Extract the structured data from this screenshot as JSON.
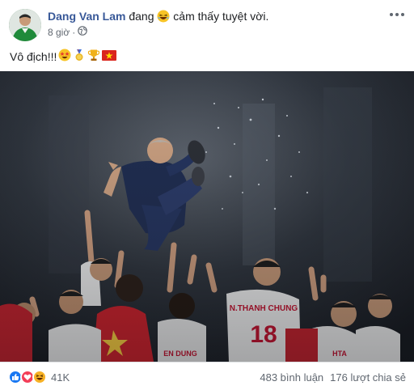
{
  "post": {
    "author": "Dang Van Lam",
    "feeling_prefix": "đang",
    "feeling_icon": "laughing-emoji",
    "feeling_text": "cảm thấy tuyệt vời.",
    "timestamp": "8 giờ",
    "privacy_icon": "globe-icon",
    "caption_text": "Vô địch!!!",
    "caption_emojis": [
      "star-struck-emoji",
      "medal-icon",
      "trophy-icon",
      "vietnam-flag-icon"
    ]
  },
  "photo": {
    "jersey_name": "N.THANH CHUNG",
    "jersey_number": "18",
    "jersey_name_small": "EN DUNG",
    "jersey_name_right": "HTA"
  },
  "footer": {
    "reactions": [
      "like-icon",
      "love-icon",
      "haha-icon"
    ],
    "reaction_count": "41K",
    "comments": "483 bình luận",
    "shares": "176 lượt chia sẻ"
  },
  "colors": {
    "author_link": "#385898",
    "secondary_text": "#606770",
    "like_blue": "#1877f2",
    "love_red": "#f33e58",
    "haha_yellow": "#f7b125",
    "jersey_red": "#c8102e"
  }
}
